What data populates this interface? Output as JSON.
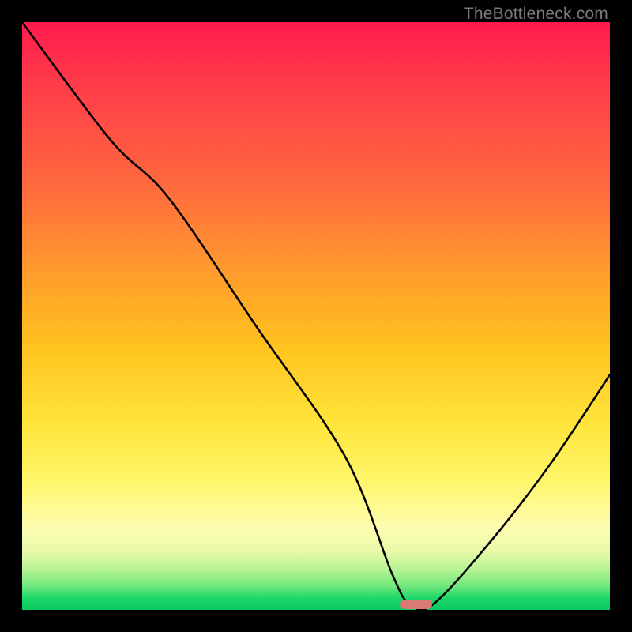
{
  "watermark": "TheBottleneck.com",
  "colors": {
    "background": "#000000",
    "curve": "#000000",
    "marker": "#d97a74"
  },
  "chart_data": {
    "type": "line",
    "title": "",
    "xlabel": "",
    "ylabel": "",
    "xlim": [
      0,
      100
    ],
    "ylim": [
      0,
      100
    ],
    "grid": false,
    "legend": false,
    "series": [
      {
        "name": "bottleneck-curve",
        "x": [
          0,
          15,
          25,
          40,
          55,
          63,
          66,
          70,
          80,
          90,
          100
        ],
        "values": [
          100,
          80,
          70,
          48,
          26,
          6,
          1,
          1,
          12,
          25,
          40
        ]
      }
    ],
    "marker": {
      "x_pct": 67,
      "width_pct": 5.6
    }
  }
}
